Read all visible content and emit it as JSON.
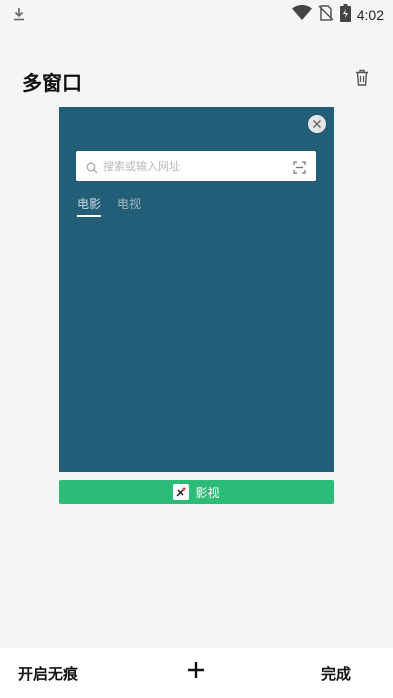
{
  "status_bar": {
    "time": "4:02"
  },
  "header": {
    "title": "多窗口"
  },
  "window_card": {
    "search_placeholder": "搜索或输入网址",
    "tabs": [
      {
        "label": "电影",
        "active": true
      },
      {
        "label": "电视",
        "active": false
      }
    ],
    "app_label": "影视"
  },
  "bottom_bar": {
    "incognito_label": "开启无痕",
    "done_label": "完成"
  },
  "colors": {
    "card_bg": "#235e78",
    "label_bar": "#2bbd77"
  }
}
